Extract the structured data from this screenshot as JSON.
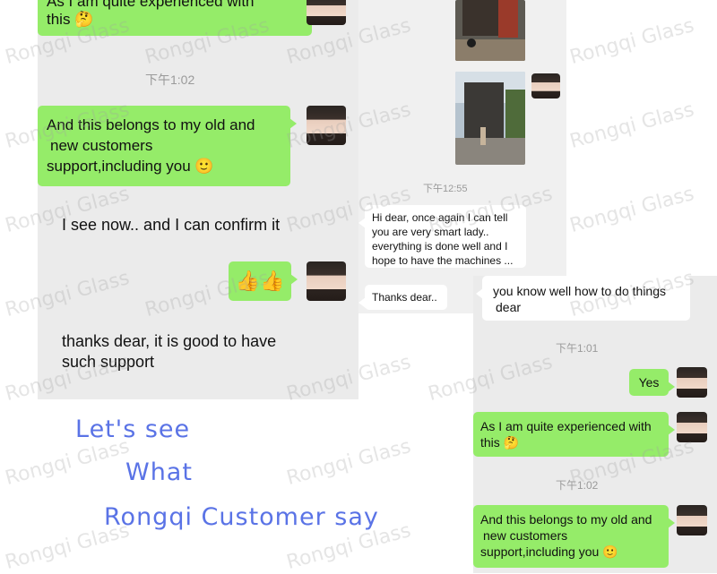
{
  "left_chat": {
    "messages": [
      {
        "text_line1": "As I am quite experienced with",
        "text_line2": "this"
      },
      {
        "timestamp": "下午1:02"
      },
      {
        "text_line1": "And this belongs to my old and",
        "text_line2": "new customers",
        "text_line3": "support,including you"
      },
      {
        "text": "I see now.. and I can confirm it"
      },
      {
        "emoji": "👍👍"
      },
      {
        "text_line1": "thanks dear, it is good to have",
        "text_line2": "such support"
      }
    ]
  },
  "middle_chat": {
    "timestamp": "下午12:55",
    "message_line1": "Hi dear, once again I can tell",
    "message_line2": "you are very smart lady..",
    "message_line3": "everything is done well and I",
    "message_line4": "hope to have the machines ...",
    "thanks_text": "Thanks dear.."
  },
  "right_chat": {
    "top_text_line1": "you know well how to do things",
    "top_text_line2": "dear",
    "timestamp1": "下午1:01",
    "yes_text": "Yes",
    "exp_line1": "As I am quite experienced with",
    "exp_line2": "this",
    "timestamp2": "下午1:02",
    "belong_line1": "And this belongs to my old and",
    "belong_line2": "new customers",
    "belong_line3": "support,including you"
  },
  "caption": {
    "line1": "Let's see",
    "line2": "What",
    "line3": "Rongqi Customer say"
  },
  "watermark_text": "Rongqi Glass",
  "colors": {
    "bubble_green": "#95ec69",
    "chat_bg": "#ebebeb",
    "caption_blue": "#5a73e6"
  }
}
